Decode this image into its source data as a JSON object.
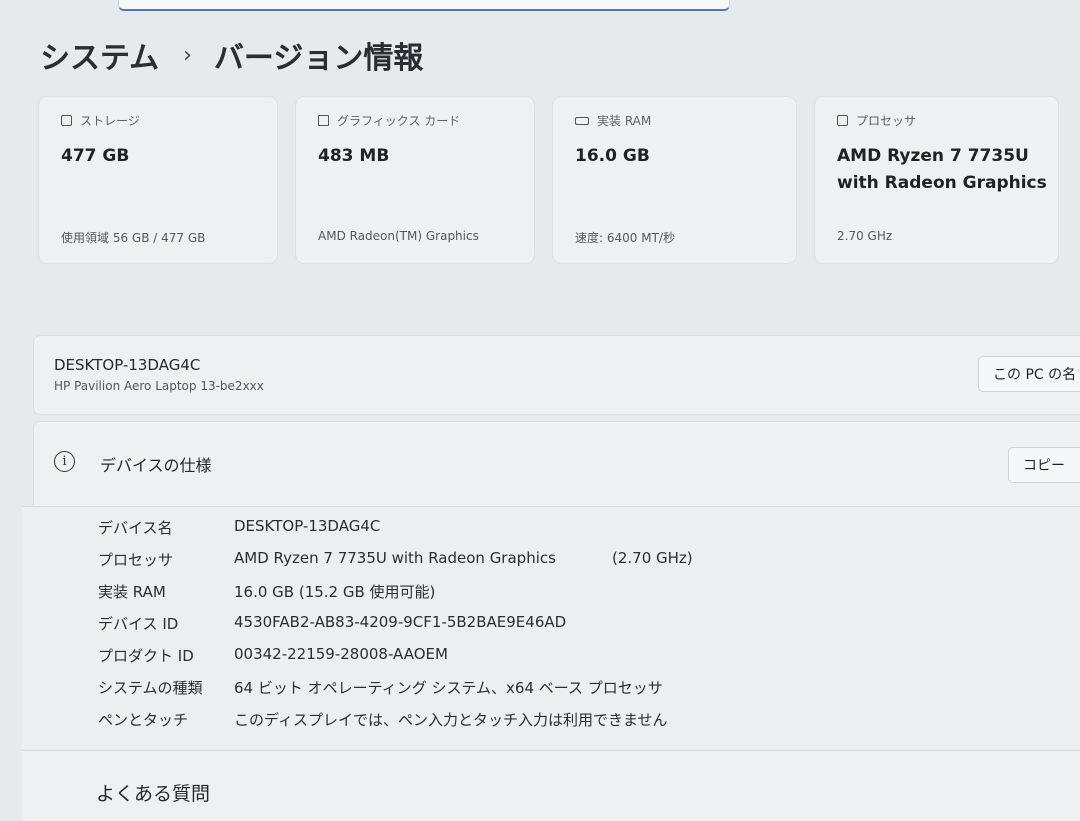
{
  "breadcrumb": {
    "parent": "システム",
    "current": "バージョン情報"
  },
  "cards": [
    {
      "label": "ストレージ",
      "icon": "storage-icon",
      "value_line1": "477 GB",
      "value_line2": "",
      "sub": "使用領域 56 GB / 477 GB"
    },
    {
      "label": "グラフィックス カード",
      "icon": "graphics-card-icon",
      "value_line1": "483 MB",
      "value_line2": "",
      "sub": "AMD Radeon(TM) Graphics"
    },
    {
      "label": "実装 RAM",
      "icon": "ram-icon",
      "value_line1": "16.0 GB",
      "value_line2": "",
      "sub": "速度: 6400 MT/秒"
    },
    {
      "label": "プロセッサ",
      "icon": "processor-icon",
      "value_line1": "AMD Ryzen 7 7735U",
      "value_line2": "with Radeon Graphics",
      "sub": "2.70 GHz"
    }
  ],
  "device": {
    "name": "DESKTOP-13DAG4C",
    "model": "HP Pavilion Aero Laptop 13-be2xxx",
    "rename_label": "この PC の名"
  },
  "specs": {
    "title": "デバイスの仕様",
    "copy_label": "コピー",
    "rows": [
      {
        "key": "デバイス名",
        "value": "DESKTOP-13DAG4C",
        "extra": ""
      },
      {
        "key": "プロセッサ",
        "value": "AMD Ryzen 7 7735U with Radeon Graphics",
        "extra": "(2.70 GHz)"
      },
      {
        "key": "実装 RAM",
        "value": "16.0 GB (15.2 GB 使用可能)",
        "extra": ""
      },
      {
        "key": "デバイス ID",
        "value": "4530FAB2-AB83-4209-9CF1-5B2BAE9E46AD",
        "extra": ""
      },
      {
        "key": "プロダクト ID",
        "value": "00342-22159-28008-AAOEM",
        "extra": ""
      },
      {
        "key": "システムの種類",
        "value": "64 ビット オペレーティング システム、x64 ベース プロセッサ",
        "extra": ""
      },
      {
        "key": "ペンとタッチ",
        "value": "このディスプレイでは、ペン入力とタッチ入力は利用できません",
        "extra": ""
      }
    ]
  },
  "faq": {
    "title": "よくある質問"
  }
}
